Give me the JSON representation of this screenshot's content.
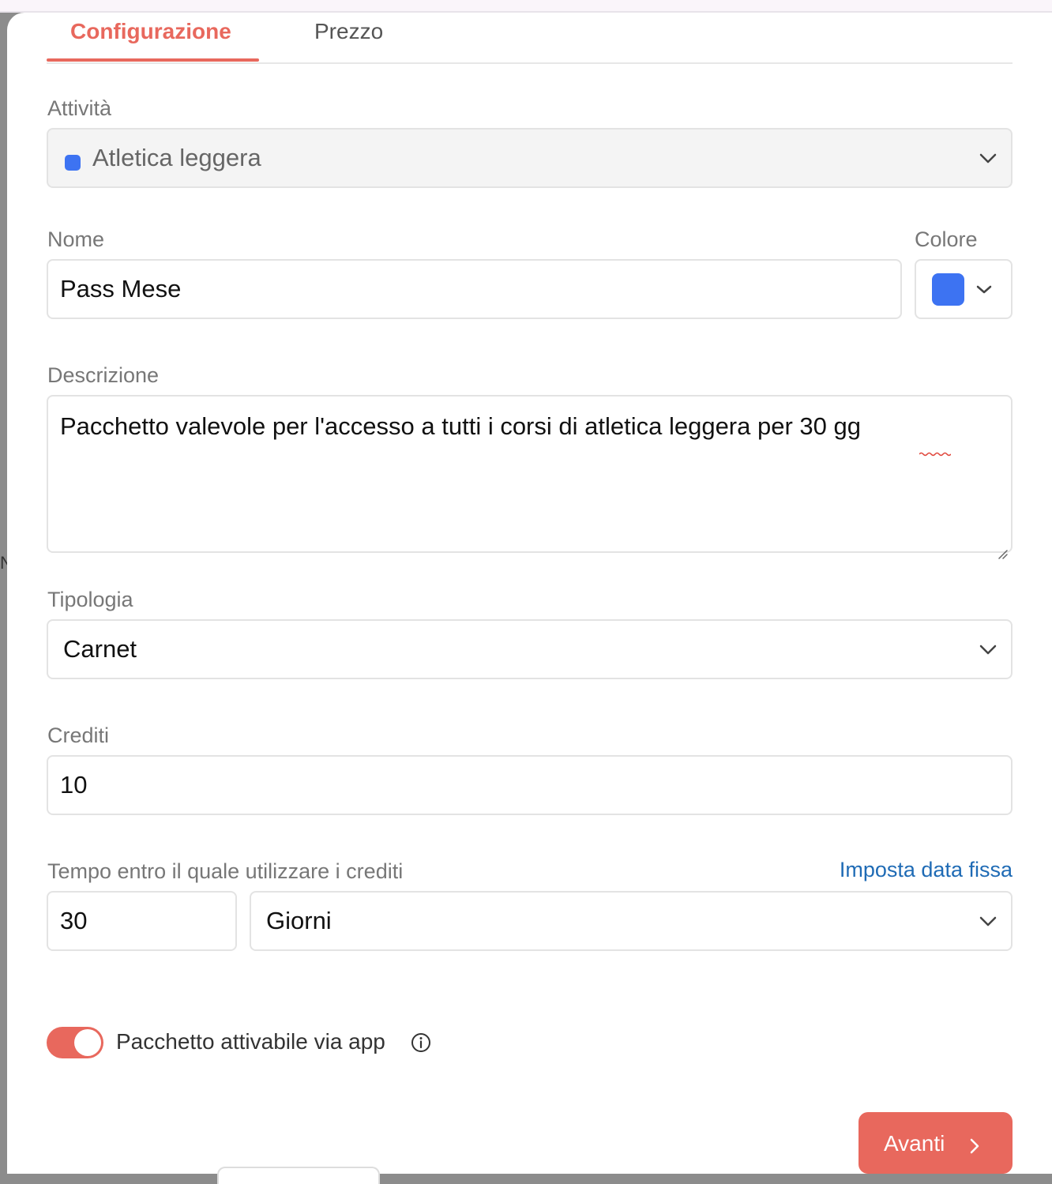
{
  "tabs": [
    {
      "label": "Configurazione",
      "active": true
    },
    {
      "label": "Prezzo",
      "active": false
    }
  ],
  "activity": {
    "label": "Attività",
    "value": "Atletica leggera",
    "color": "#3d73f2"
  },
  "name": {
    "label": "Nome",
    "value": "Pass Mese"
  },
  "color": {
    "label": "Colore",
    "value": "#3d73f2"
  },
  "description": {
    "label": "Descrizione",
    "value": "Pacchetto valevole per l'accesso a tutti i corsi di atletica leggera per 30 gg"
  },
  "type": {
    "label": "Tipologia",
    "value": "Carnet"
  },
  "credits": {
    "label": "Crediti",
    "value": "10"
  },
  "validity": {
    "label": "Tempo entro il quale utilizzare i crediti",
    "fixed_date_link": "Imposta data fissa",
    "amount": "30",
    "unit": "Giorni"
  },
  "app_activation": {
    "label": "Pacchetto attivabile via app",
    "enabled": true
  },
  "next_button": {
    "label": "Avanti"
  },
  "colors": {
    "accent": "#e8685d",
    "link": "#1f6bb5",
    "activity_blue": "#3d73f2"
  }
}
